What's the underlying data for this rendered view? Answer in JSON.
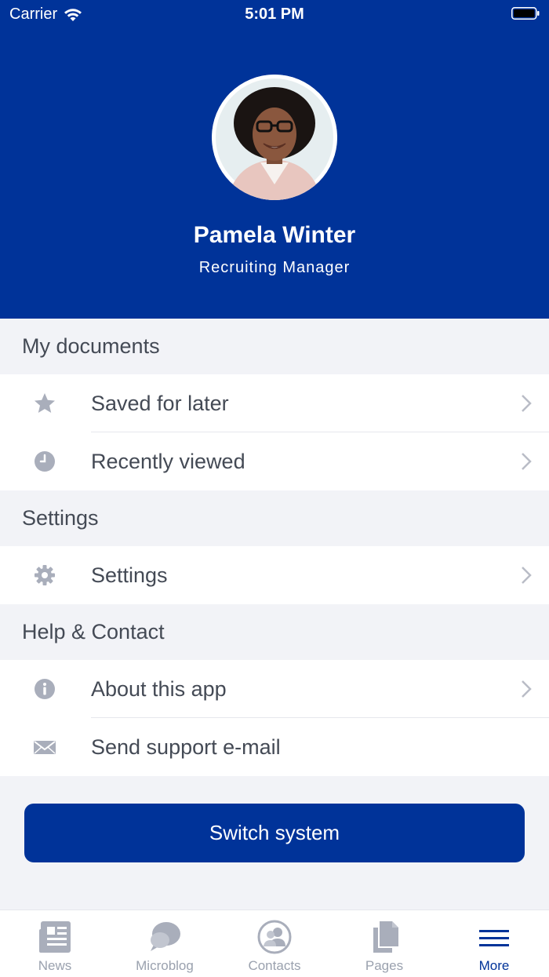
{
  "status_bar": {
    "carrier": "Carrier",
    "time": "5:01 PM"
  },
  "profile": {
    "name": "Pamela Winter",
    "role": "Recruiting Manager"
  },
  "sections": {
    "my_documents": {
      "title": "My documents",
      "items": [
        {
          "label": "Saved for later",
          "icon": "star-icon"
        },
        {
          "label": "Recently viewed",
          "icon": "clock-icon"
        }
      ]
    },
    "settings": {
      "title": "Settings",
      "items": [
        {
          "label": "Settings",
          "icon": "gear-icon"
        }
      ]
    },
    "help_contact": {
      "title": "Help & Contact",
      "items": [
        {
          "label": "About this app",
          "icon": "info-icon"
        },
        {
          "label": "Send support e-mail",
          "icon": "mail-icon"
        }
      ]
    }
  },
  "switch_button": {
    "label": "Switch system"
  },
  "tab_bar": {
    "tabs": [
      {
        "label": "News",
        "icon": "newspaper-icon",
        "active": false
      },
      {
        "label": "Microblog",
        "icon": "chat-bubble-icon",
        "active": false
      },
      {
        "label": "Contacts",
        "icon": "contacts-icon",
        "active": false
      },
      {
        "label": "Pages",
        "icon": "pages-icon",
        "active": false
      },
      {
        "label": "More",
        "icon": "menu-icon",
        "active": true
      }
    ]
  },
  "colors": {
    "brand": "#003399",
    "inactive_icon": "#a9aebb",
    "section_background": "#f2f3f7",
    "text": "#444a55"
  }
}
